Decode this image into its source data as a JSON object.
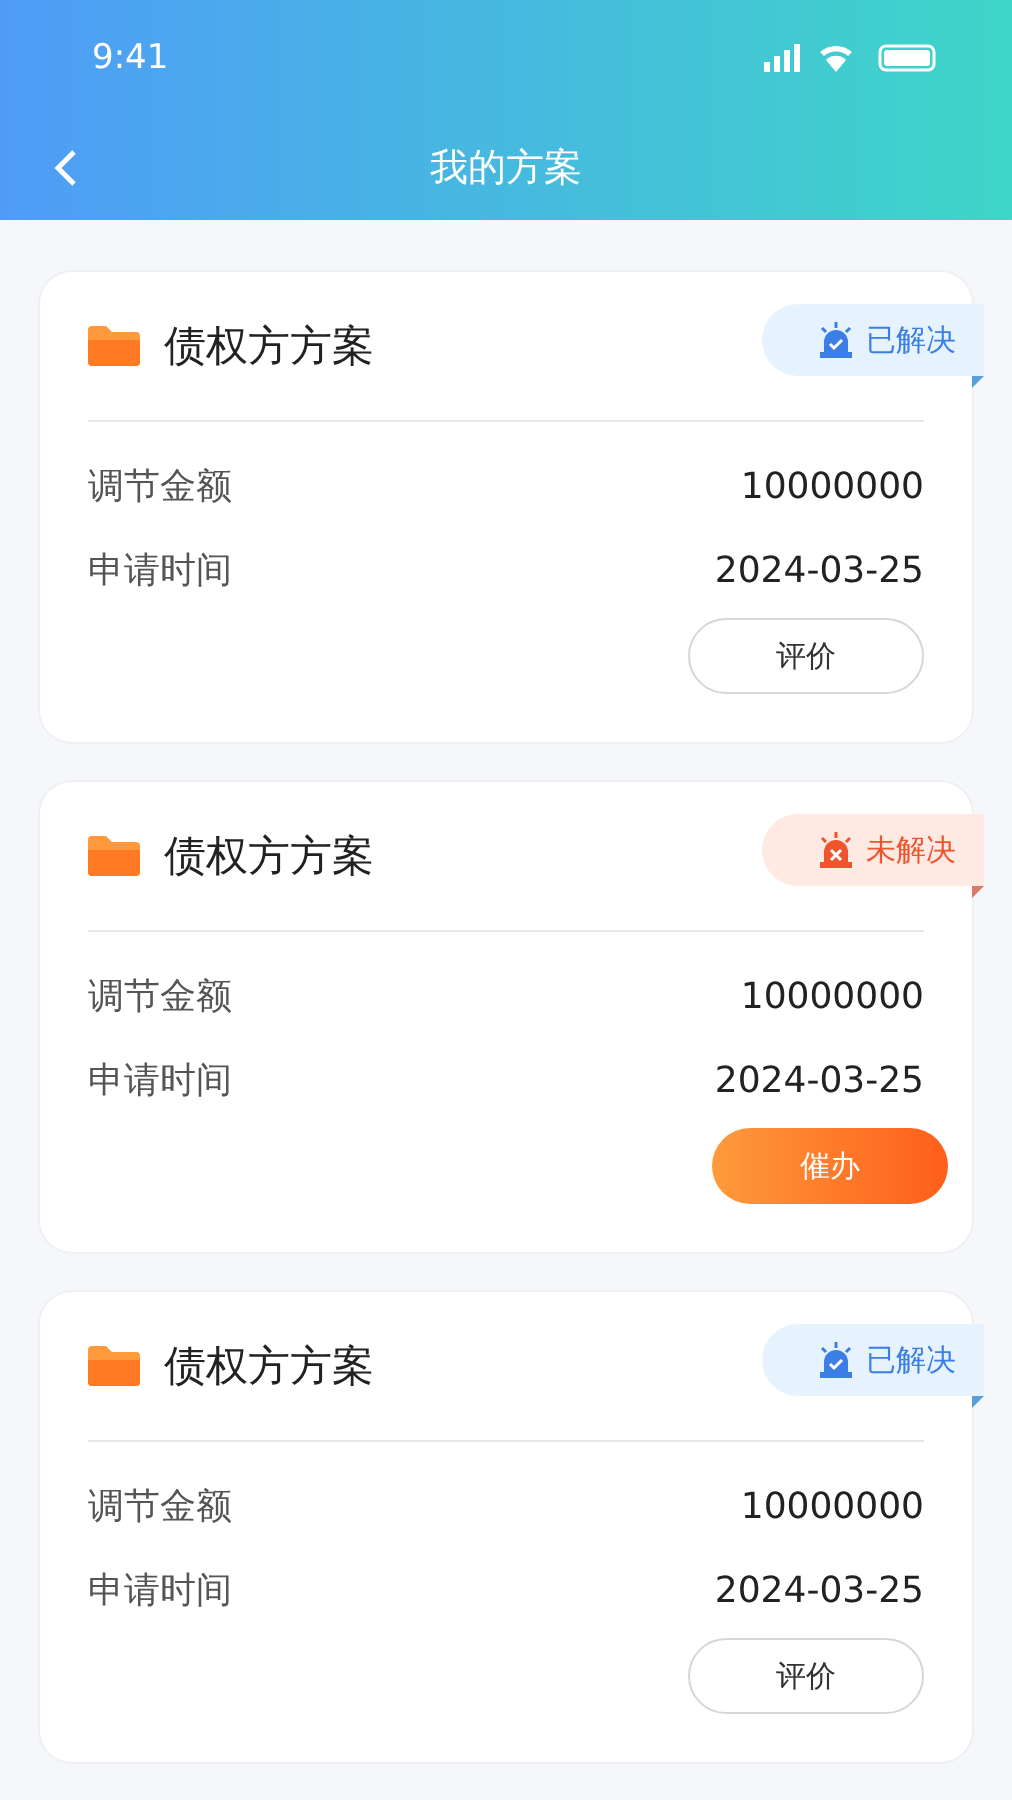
{
  "status_bar": {
    "time": "9:41"
  },
  "nav": {
    "title": "我的方案"
  },
  "plans": [
    {
      "title": "债权方方案",
      "status": {
        "kind": "resolved",
        "label": "已解决"
      },
      "fields": [
        {
          "label": "调节金额",
          "value": "10000000"
        },
        {
          "label": "申请时间",
          "value": "2024-03-25"
        }
      ],
      "action": {
        "kind": "outline",
        "label": "评价"
      }
    },
    {
      "title": "债权方方案",
      "status": {
        "kind": "unresolved",
        "label": "未解决"
      },
      "fields": [
        {
          "label": "调节金额",
          "value": "10000000"
        },
        {
          "label": "申请时间",
          "value": "2024-03-25"
        }
      ],
      "action": {
        "kind": "primary",
        "label": "催办"
      }
    },
    {
      "title": "债权方方案",
      "status": {
        "kind": "resolved",
        "label": "已解决"
      },
      "fields": [
        {
          "label": "调节金额",
          "value": "10000000"
        },
        {
          "label": "申请时间",
          "value": "2024-03-25"
        }
      ],
      "action": {
        "kind": "outline",
        "label": "评价"
      }
    }
  ]
}
